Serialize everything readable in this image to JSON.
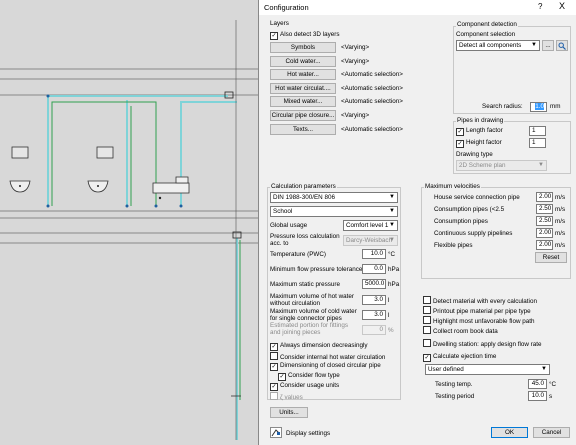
{
  "dialog": {
    "title": "Configuration",
    "help_label": "?",
    "close_label": "X",
    "layers": {
      "group_label": "Layers",
      "also_detect_3d": "Also detect 3D layers",
      "rows": [
        {
          "button": "Symbols",
          "value": "<Varying>"
        },
        {
          "button": "Cold water...",
          "value": "<Varying>"
        },
        {
          "button": "Hot water...",
          "value": "<Automatic selection>"
        },
        {
          "button": "Hot water circulat....",
          "value": "<Automatic selection>"
        },
        {
          "button": "Mixed water...",
          "value": "<Automatic selection>"
        },
        {
          "button": "Circular pipe closure...",
          "value": "<Varying>"
        },
        {
          "button": "Texts...",
          "value": "<Automatic selection>"
        }
      ]
    },
    "component_detection": {
      "group_label": "Component detection",
      "selection_label": "Component selection",
      "selection_value": "Detect all components",
      "more_button": "...",
      "search_radius_label": "Search radius:",
      "search_radius_value": "1.0",
      "search_radius_unit": "mm"
    },
    "pipes_in_drawing": {
      "group_label": "Pipes in drawing",
      "length_factor_label": "Length factor",
      "length_factor_value": "1",
      "height_factor_label": "Height factor",
      "height_factor_value": "1",
      "drawing_type_label": "Drawing type",
      "drawing_type_value": "2D Scheme plan"
    },
    "calculation": {
      "group_label": "Calculation parameters",
      "standard": "DIN 1988-300/EN 806",
      "building": "School",
      "global_usage_label": "Global usage",
      "global_usage_value": "Comfort level 1",
      "pressure_loss_label": "Pressure loss calculation acc. to",
      "pressure_loss_value": "Darcy-Weisbach",
      "temperature_label": "Temperature (PWC)",
      "temperature_value": "10.0",
      "temperature_unit": "°C",
      "min_flow_label": "Minimum flow pressure tolerance",
      "min_flow_value": "0.0",
      "min_flow_unit": "hPa",
      "max_static_label": "Maximum static pressure",
      "max_static_value": "5000.0",
      "max_static_unit": "hPa",
      "max_hot_label": "Maximum volume of hot water without circulation",
      "max_hot_value": "3.0",
      "max_hot_unit": "l",
      "max_cold_label": "Maximum volume of cold water for single connector pipes",
      "max_cold_value": "3.0",
      "max_cold_unit": "l",
      "estimated_label": "Estimated portion for fittings and joining pieces",
      "estimated_value": "0",
      "estimated_unit": "%",
      "checks": [
        {
          "label": "Always dimension decreasingly",
          "checked": true
        },
        {
          "label": "Consider internal hot water circulation",
          "checked": false
        },
        {
          "label": "Dimensioning of closed circular pipe",
          "checked": true
        },
        {
          "label": "Consider flow type",
          "checked": true
        },
        {
          "label": "Consider usage units",
          "checked": true
        },
        {
          "label": "ζ values",
          "checked": false
        }
      ],
      "units_button": "Units..."
    },
    "velocities": {
      "group_label": "Maximum velocities",
      "rows": [
        {
          "label": "House service connection pipe",
          "value": "2.00",
          "unit": "m/s"
        },
        {
          "label": "Consumption pipes (<2.5",
          "value": "2.50",
          "unit": "m/s"
        },
        {
          "label": "Consumption pipes",
          "value": "2.50",
          "unit": "m/s"
        },
        {
          "label": "Continuous supply pipelines",
          "value": "2.00",
          "unit": "m/s"
        },
        {
          "label": "Flexible pipes",
          "value": "2.00",
          "unit": "m/s"
        }
      ],
      "reset_button": "Reset"
    },
    "options": {
      "checks": [
        {
          "label": "Detect material with every calculation",
          "checked": false
        },
        {
          "label": "Printout pipe material per pipe type",
          "checked": false
        },
        {
          "label": "Highlight most unfavorable flow path",
          "checked": false
        },
        {
          "label": "Collect room book data",
          "checked": false
        },
        {
          "label": "Dwelling station: apply design flow rate",
          "checked": false
        },
        {
          "label": "Calculate ejection time",
          "checked": true
        }
      ],
      "ejection_mode": "User defined",
      "testing_temp_label": "Testing temp.",
      "testing_temp_value": "45.0",
      "testing_temp_unit": "°C",
      "testing_period_label": "Testing period",
      "testing_period_value": "10.0",
      "testing_period_unit": "s"
    },
    "footer": {
      "display_settings": "Display settings",
      "ok": "OK",
      "cancel": "Cancel"
    }
  },
  "colors": {
    "pipe_cyan": "#7fd3d8",
    "pipe_green": "#2fa14f",
    "cad_background": "#d8d8d8",
    "selection_blue": "#3399ff"
  }
}
